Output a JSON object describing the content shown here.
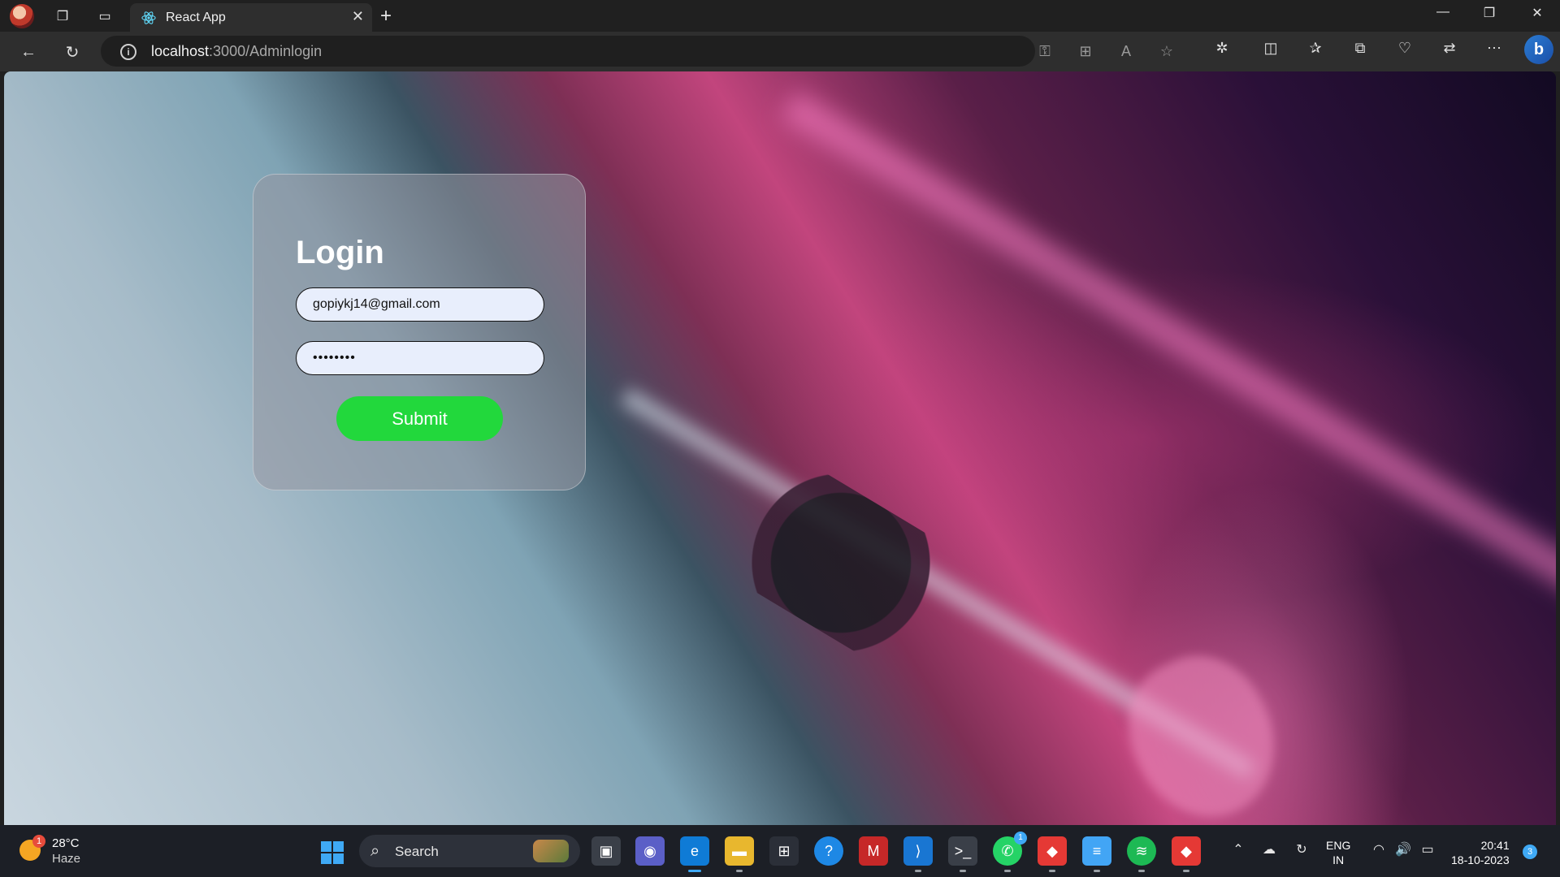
{
  "browser": {
    "tab_title": "React App",
    "url_host": "localhost",
    "url_path": ":3000/Adminlogin",
    "new_tab_symbol": "+",
    "close_tab_symbol": "✕"
  },
  "login": {
    "title": "Login",
    "email_value": "gopiykj14@gmail.com",
    "password_value": "••••••••",
    "submit_label": "Submit"
  },
  "taskbar": {
    "weather_temp": "28°C",
    "weather_condition": "Haze",
    "weather_badge": "1",
    "search_label": "Search",
    "whatsapp_badge": "1",
    "lang_top": "ENG",
    "lang_bottom": "IN",
    "time": "20:41",
    "date": "18-10-2023",
    "notification_count": "3"
  },
  "colors": {
    "submit_green": "#22d83c",
    "input_background": "#e8eefc",
    "accent_blue": "#3fa9f5"
  }
}
